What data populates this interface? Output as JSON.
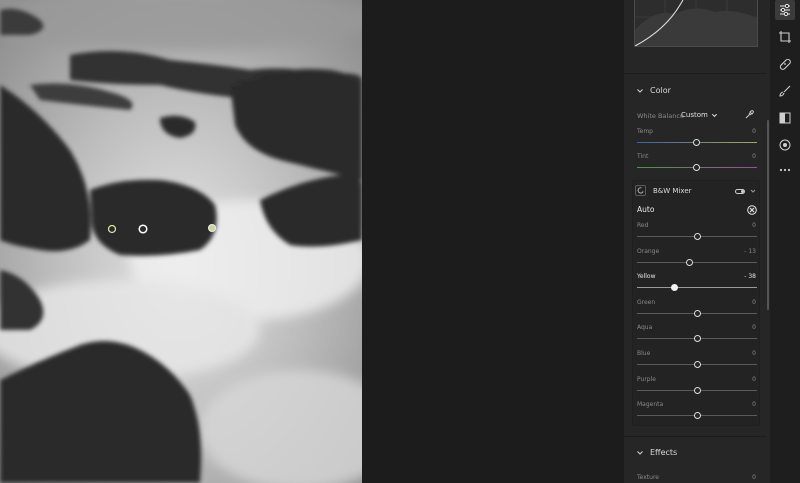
{
  "photo": {
    "description_icon": "landscape-photo"
  },
  "color_section": {
    "title": "Color",
    "white_balance_label": "White Balance",
    "white_balance_value": "Custom",
    "temp_label": "Temp",
    "temp_value": "0",
    "tint_label": "Tint",
    "tint_value": "0"
  },
  "bw_mixer": {
    "title": "B&W Mixer",
    "auto_label": "Auto",
    "sliders": [
      {
        "label": "Red",
        "value": "0",
        "level": 0
      },
      {
        "label": "Orange",
        "value": "- 13",
        "level": -13
      },
      {
        "label": "Yellow",
        "value": "- 38",
        "level": -38
      },
      {
        "label": "Green",
        "value": "0",
        "level": 0
      },
      {
        "label": "Aqua",
        "value": "0",
        "level": 0
      },
      {
        "label": "Blue",
        "value": "0",
        "level": 0
      },
      {
        "label": "Purple",
        "value": "0",
        "level": 0
      },
      {
        "label": "Magenta",
        "value": "0",
        "level": 0
      }
    ]
  },
  "effects_section": {
    "title": "Effects",
    "texture_label": "Texture",
    "texture_value": "0"
  },
  "toolstrip": [
    "edit-icon",
    "crop-icon",
    "healing-icon",
    "brush-icon",
    "gradient-icon",
    "radial-icon",
    "more-icon"
  ],
  "colors": {
    "accent": "#ffffff",
    "panel": "#262626",
    "canvas": "#1c1c1c"
  }
}
